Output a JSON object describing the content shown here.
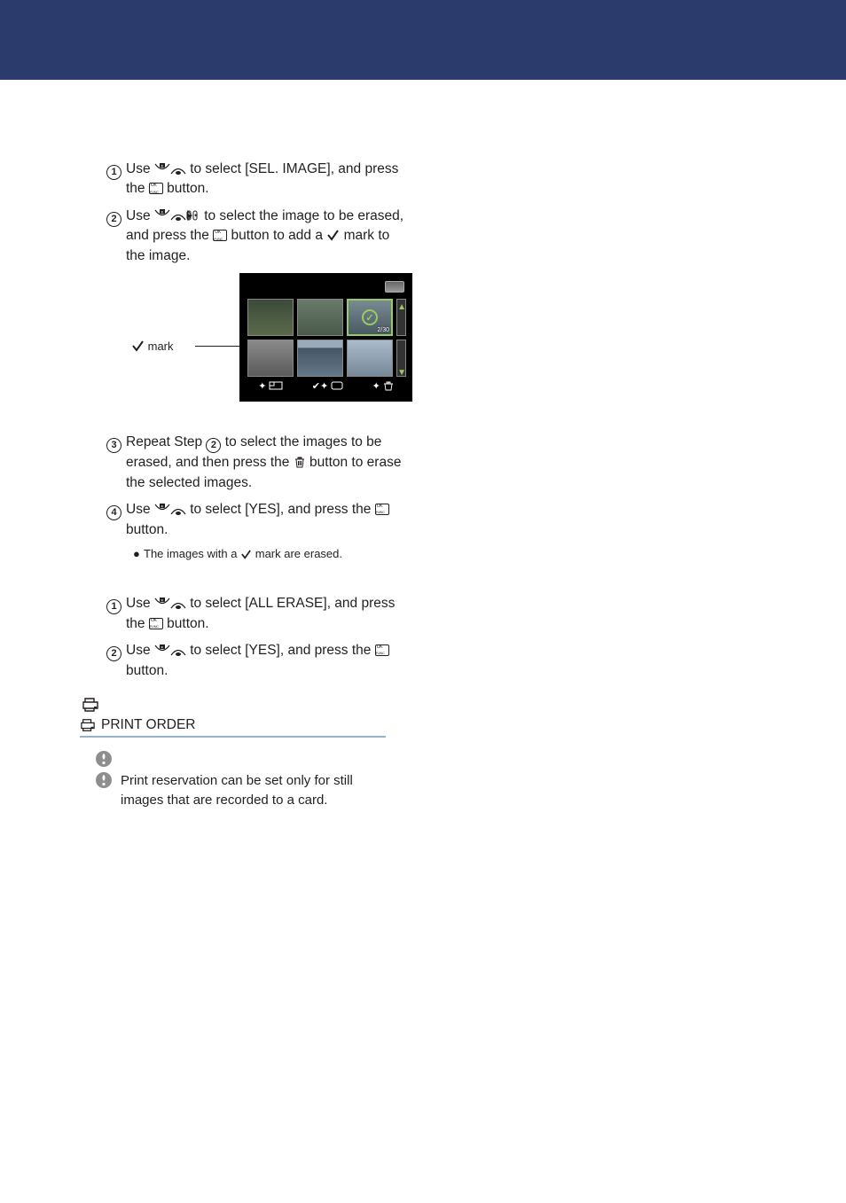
{
  "erase_sel": {
    "step1": {
      "pre": "Use ",
      "mid": " to select [SEL. IMAGE], and press the ",
      "post": " button."
    },
    "step2": {
      "pre": "Use ",
      "mid": " to select the image to be erased, and press the ",
      "mid2": " button to add a ",
      "post": " mark to the image."
    },
    "figure": {
      "label": " mark",
      "sel_thumb_counter": "2/30"
    },
    "step3": {
      "pre": "Repeat Step ",
      "step_ref": "2",
      "mid": " to select the images to be erased, and then press the ",
      "post": " button to erase the selected images."
    },
    "step4": {
      "pre": "Use ",
      "mid": " to select [YES], and press the ",
      "post": " button."
    },
    "note": {
      "pre": "The images with a ",
      "post": " mark are erased."
    }
  },
  "erase_all": {
    "step1": {
      "pre": "Use ",
      "mid": " to select [ALL ERASE], and press the ",
      "post": " button."
    },
    "step2": {
      "pre": "Use ",
      "mid": " to select [YES], and press the ",
      "post": " button."
    }
  },
  "print_order": {
    "heading": " PRINT ORDER",
    "note": "Print reservation can be set only for still images that are recorded to a card."
  }
}
